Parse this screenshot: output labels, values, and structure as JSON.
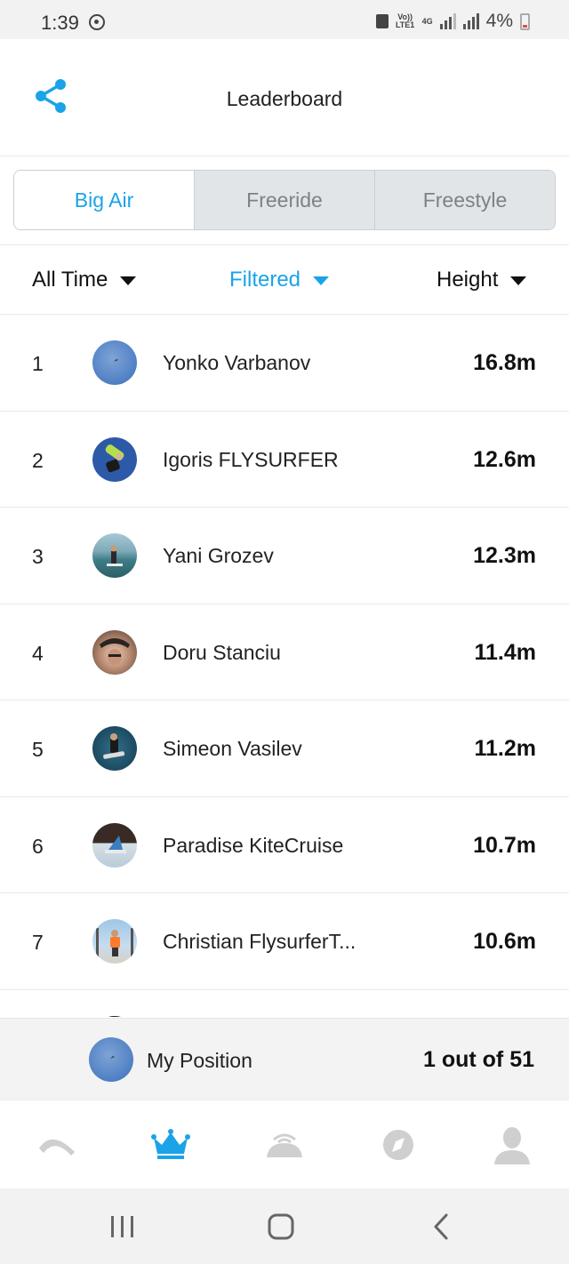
{
  "status_bar": {
    "time": "1:39",
    "volte_label": "Vo)) LTE1",
    "network_label": "4G",
    "battery": "4%"
  },
  "header": {
    "title": "Leaderboard",
    "share_icon": "share-icon"
  },
  "tabs": [
    {
      "label": "Big Air",
      "active": true
    },
    {
      "label": "Freeride",
      "active": false
    },
    {
      "label": "Freestyle",
      "active": false
    }
  ],
  "filters": {
    "period": "All Time",
    "filter": "Filtered",
    "metric": "Height"
  },
  "leaderboard": [
    {
      "rank": "1",
      "name": "Yonko Varbanov",
      "value": "16.8m"
    },
    {
      "rank": "2",
      "name": "Igoris FLYSURFER",
      "value": "12.6m"
    },
    {
      "rank": "3",
      "name": "Yani Grozev",
      "value": "12.3m"
    },
    {
      "rank": "4",
      "name": "Doru Stanciu",
      "value": "11.4m"
    },
    {
      "rank": "5",
      "name": "Simeon Vasilev",
      "value": "11.2m"
    },
    {
      "rank": "6",
      "name": "Paradise KiteCruise",
      "value": "10.7m"
    },
    {
      "rank": "7",
      "name": "Christian FlysurferT...",
      "value": "10.6m"
    }
  ],
  "my_position": {
    "label": "My Position",
    "value": "1 out of 51"
  },
  "bottom_nav": [
    "kite-icon",
    "crown-icon",
    "dome-icon",
    "compass-icon",
    "profile-icon"
  ],
  "colors": {
    "accent": "#1ba3e8",
    "inactive_tab_bg": "#e2e5e8",
    "nav_icon_inactive": "#cfcfcf"
  }
}
